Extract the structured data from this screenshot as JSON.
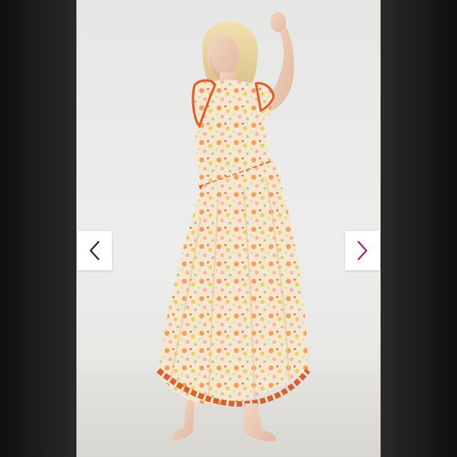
{
  "viewer": {
    "image_subject": "product-photo",
    "prev_icon": "chevron-left-icon",
    "next_icon": "chevron-right-icon"
  },
  "colors": {
    "side_background": "#1c1c1c",
    "photo_background": "#e6e6e4",
    "nav_button_background": "#ffffff",
    "prev_arrow": "#2b2b2b",
    "next_arrow": "#a0268a"
  }
}
